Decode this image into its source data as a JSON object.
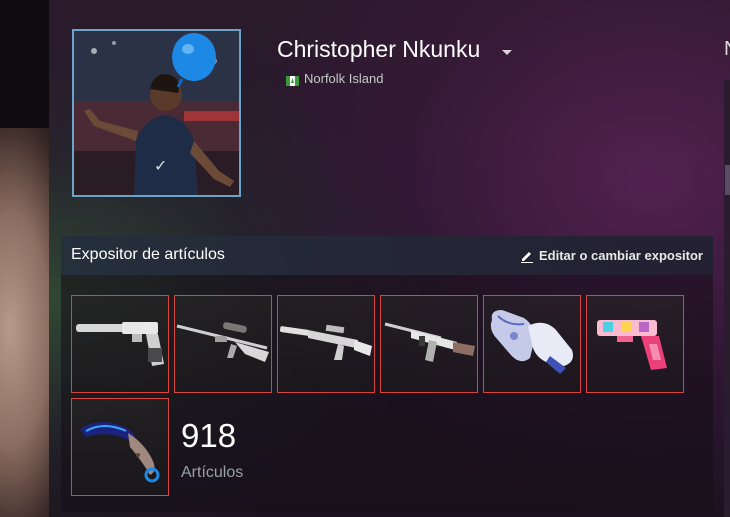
{
  "profile": {
    "persona_name": "Christopher Nkunku",
    "location": "Norfolk Island",
    "flag_icon": "norfolk-island-flag-icon"
  },
  "showcase": {
    "title": "Expositor de artículos",
    "edit_label": "Editar o cambiar expositor",
    "items": [
      {
        "icon": "silenced-pistol-icon"
      },
      {
        "icon": "sniper-rifle-icon"
      },
      {
        "icon": "silenced-rifle-icon"
      },
      {
        "icon": "assault-rifle-icon"
      },
      {
        "icon": "gloves-icon"
      },
      {
        "icon": "pistol-skin-icon"
      },
      {
        "icon": "karambit-knife-icon"
      }
    ],
    "item_count": "918",
    "item_count_label": "Artículos",
    "item_border_color": "#d9453c"
  },
  "colors": {
    "avatar_border": "#6aa5c9",
    "accent_purple": "#5a2a58"
  },
  "right_edge_glyph": "N"
}
